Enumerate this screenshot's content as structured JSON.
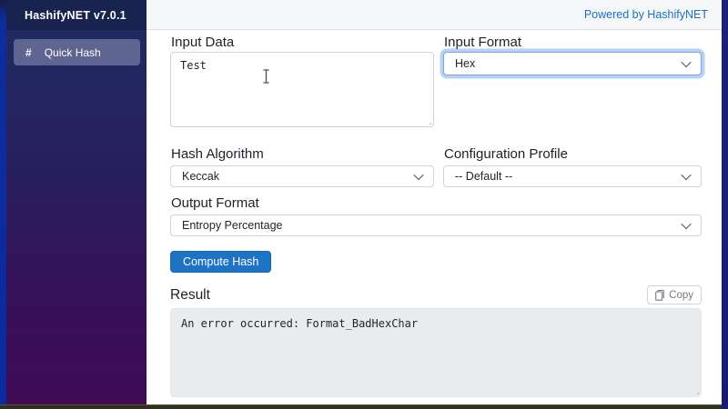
{
  "app": {
    "window_title": "HashifyNET v7.0.1",
    "powered_by_link": "Powered by HashifyNET"
  },
  "sidebar": {
    "items": [
      {
        "icon_glyph": "#",
        "label": "Quick Hash",
        "active": true
      }
    ]
  },
  "form": {
    "input_data": {
      "label": "Input Data",
      "value": "Test"
    },
    "input_format": {
      "label": "Input Format",
      "selected": "Hex",
      "focused": true
    },
    "hash_algorithm": {
      "label": "Hash Algorithm",
      "selected": "Keccak"
    },
    "configuration_profile": {
      "label": "Configuration Profile",
      "selected": "-- Default --"
    },
    "output_format": {
      "label": "Output Format",
      "selected": "Entropy Percentage"
    },
    "compute_button_label": "Compute Hash"
  },
  "result": {
    "heading": "Result",
    "copy_button_label": "Copy",
    "output_text": "An error occurred: Format_BadHexChar"
  },
  "icons": {
    "sidebar_item": "hash-icon",
    "select_caret": "chevron-down-icon",
    "copy_button": "clipboard-icon",
    "mouse_pointer": "text-cursor-icon"
  },
  "colors": {
    "link_blue": "#1a70c5",
    "primary_button_blue": "#1f73c5",
    "focus_ring_blue": "#74a7e0",
    "sidebar_gradient_top": "#202a60",
    "sidebar_gradient_bottom": "#420b57",
    "sidebar_header_navy": "#192350",
    "header_gray": "#f4f6f8",
    "result_background": "#e9ecef",
    "edge_strip_blue_left": "#0a2aa0",
    "edge_strip_navy_right": "#171d6e"
  }
}
